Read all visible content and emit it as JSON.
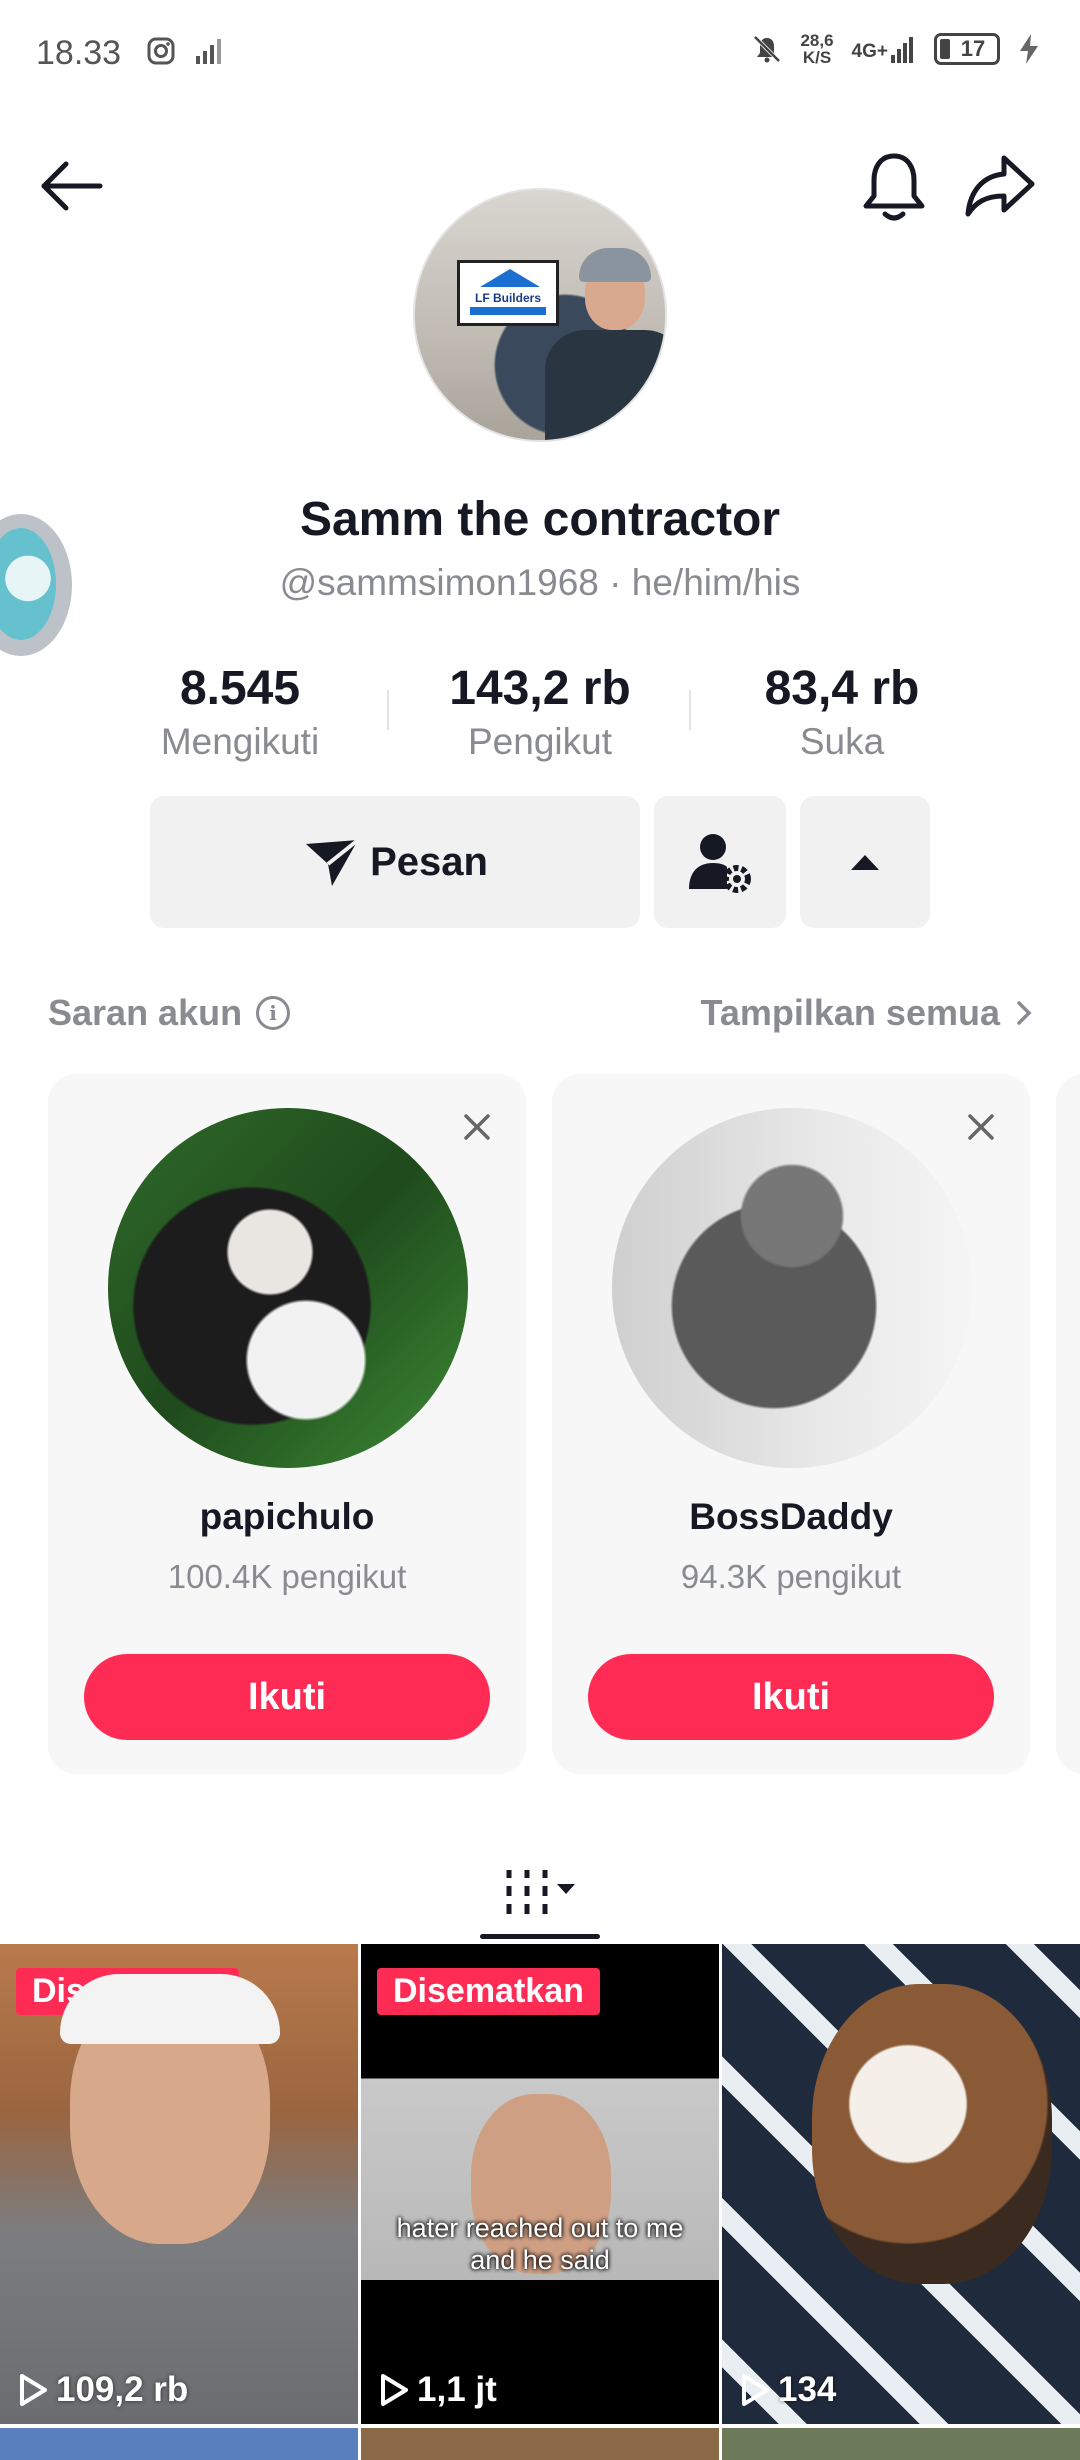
{
  "status_bar": {
    "time": "18.33",
    "net_speed_value": "28,6",
    "net_speed_unit": "K/S",
    "network": "4G+",
    "battery": "17"
  },
  "profile": {
    "display_name": "Samm the contractor",
    "handle": "@sammsimon1968",
    "pronouns": "he/him/his",
    "separator": "·",
    "avatar_sign_text": "LF Builders"
  },
  "stats": [
    {
      "value": "8.545",
      "label": "Mengikuti"
    },
    {
      "value": "143,2 rb",
      "label": "Pengikut"
    },
    {
      "value": "83,4 rb",
      "label": "Suka"
    }
  ],
  "actions": {
    "message_label": "Pesan"
  },
  "suggestions": {
    "title": "Saran akun",
    "show_all": "Tampilkan semua",
    "cards": [
      {
        "username": "papichulo",
        "followers": "100.4K pengikut",
        "follow_label": "Ikuti"
      },
      {
        "username": "BossDaddy",
        "followers": "94.3K pengikut",
        "follow_label": "Ikuti"
      }
    ]
  },
  "videos": [
    {
      "badge": "Disematkan",
      "views": "109,2 rb",
      "caption": ""
    },
    {
      "badge": "Disematkan",
      "views": "1,1 jt",
      "caption": "hater reached out to me and he said"
    },
    {
      "badge": "",
      "views": "134",
      "caption": ""
    }
  ],
  "colors": {
    "accent": "#fe2c55",
    "text_primary": "#161823",
    "text_secondary": "#8a8b91",
    "button_bg": "#f1f1f2"
  }
}
